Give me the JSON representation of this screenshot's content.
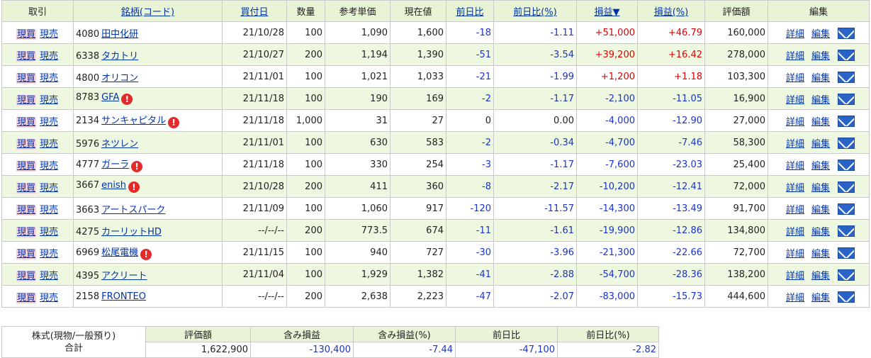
{
  "headers": {
    "trade": "取引",
    "stock": "銘柄(コード)",
    "buy_date": "買付日",
    "qty": "数量",
    "ref_price": "参考単価",
    "cur_price": "現在値",
    "day_change": "前日比",
    "day_change_pct": "前日比(%)",
    "pnl": "損益▼",
    "pnl_pct": "損益(%)",
    "valuation": "評価額",
    "edit": "編集"
  },
  "actions": {
    "buy": "現買",
    "sell": "現売",
    "detail": "詳細",
    "edit": "編集",
    "warn_icon": "!"
  },
  "rows": [
    {
      "code": "4080",
      "name": "田中化研",
      "warn": false,
      "date": "21/10/28",
      "qty": "100",
      "ref": "1,090",
      "cur": "1,600",
      "chg": "-18",
      "chg_pct": "-1.11",
      "pnl": "+51,000",
      "pnl_pct": "+46.79",
      "val": "160,000"
    },
    {
      "code": "6338",
      "name": "タカトリ",
      "warn": false,
      "date": "21/10/27",
      "qty": "200",
      "ref": "1,194",
      "cur": "1,390",
      "chg": "-51",
      "chg_pct": "-3.54",
      "pnl": "+39,200",
      "pnl_pct": "+16.42",
      "val": "278,000"
    },
    {
      "code": "4800",
      "name": "オリコン",
      "warn": false,
      "date": "21/11/01",
      "qty": "100",
      "ref": "1,021",
      "cur": "1,033",
      "chg": "-21",
      "chg_pct": "-1.99",
      "pnl": "+1,200",
      "pnl_pct": "+1.18",
      "val": "103,300"
    },
    {
      "code": "8783",
      "name": "GFA",
      "warn": true,
      "date": "21/11/18",
      "qty": "100",
      "ref": "190",
      "cur": "169",
      "chg": "-2",
      "chg_pct": "-1.17",
      "pnl": "-2,100",
      "pnl_pct": "-11.05",
      "val": "16,900"
    },
    {
      "code": "2134",
      "name": "サンキャピタル",
      "warn": true,
      "date": "21/11/18",
      "qty": "1,000",
      "ref": "31",
      "cur": "27",
      "chg": "0",
      "chg_pct": "0.00",
      "pnl": "-4,000",
      "pnl_pct": "-12.90",
      "val": "27,000"
    },
    {
      "code": "5976",
      "name": "ネツレン",
      "warn": false,
      "date": "21/11/01",
      "qty": "100",
      "ref": "630",
      "cur": "583",
      "chg": "-2",
      "chg_pct": "-0.34",
      "pnl": "-4,700",
      "pnl_pct": "-7.46",
      "val": "58,300"
    },
    {
      "code": "4777",
      "name": "ガーラ",
      "warn": true,
      "date": "21/11/18",
      "qty": "100",
      "ref": "330",
      "cur": "254",
      "chg": "-3",
      "chg_pct": "-1.17",
      "pnl": "-7,600",
      "pnl_pct": "-23.03",
      "val": "25,400"
    },
    {
      "code": "3667",
      "name": "enish",
      "warn": true,
      "date": "21/10/28",
      "qty": "200",
      "ref": "411",
      "cur": "360",
      "chg": "-8",
      "chg_pct": "-2.17",
      "pnl": "-10,200",
      "pnl_pct": "-12.41",
      "val": "72,000"
    },
    {
      "code": "3663",
      "name": "アートスパーク",
      "warn": false,
      "date": "21/11/09",
      "qty": "100",
      "ref": "1,060",
      "cur": "917",
      "chg": "-120",
      "chg_pct": "-11.57",
      "pnl": "-14,300",
      "pnl_pct": "-13.49",
      "val": "91,700"
    },
    {
      "code": "4275",
      "name": "カーリットHD",
      "warn": false,
      "date": "--/--/--",
      "qty": "200",
      "ref": "773.5",
      "cur": "674",
      "chg": "-11",
      "chg_pct": "-1.61",
      "pnl": "-19,900",
      "pnl_pct": "-12.86",
      "val": "134,800"
    },
    {
      "code": "6969",
      "name": "松尾電機",
      "warn": true,
      "date": "21/11/15",
      "qty": "100",
      "ref": "940",
      "cur": "727",
      "chg": "-30",
      "chg_pct": "-3.96",
      "pnl": "-21,300",
      "pnl_pct": "-22.66",
      "val": "72,700"
    },
    {
      "code": "4395",
      "name": "アクリート",
      "warn": false,
      "date": "21/11/04",
      "qty": "100",
      "ref": "1,929",
      "cur": "1,382",
      "chg": "-41",
      "chg_pct": "-2.88",
      "pnl": "-54,700",
      "pnl_pct": "-28.36",
      "val": "138,200"
    },
    {
      "code": "2158",
      "name": "FRONTEO",
      "warn": false,
      "date": "--/--/--",
      "qty": "200",
      "ref": "2,638",
      "cur": "2,223",
      "chg": "-47",
      "chg_pct": "-2.07",
      "pnl": "-83,000",
      "pnl_pct": "-15.73",
      "val": "444,600"
    }
  ],
  "summary": {
    "label_line1": "株式(現物/一般預り)",
    "label_line2": "合計",
    "headers": {
      "valuation": "評価額",
      "unrealized": "含み損益",
      "unrealized_pct": "含み損益(%)",
      "day_change": "前日比",
      "day_change_pct": "前日比(%)"
    },
    "values": {
      "valuation": "1,622,900",
      "unrealized": "-130,400",
      "unrealized_pct": "-7.44",
      "day_change": "-47,100",
      "day_change_pct": "-2.82"
    }
  },
  "colors": {
    "header_bg": "#e9f3d6",
    "row_alt_bg": "#eef7df",
    "link": "#0033aa",
    "negative": "#1a33cc",
    "positive": "#e00000",
    "mail_icon": "#2a63c7"
  }
}
